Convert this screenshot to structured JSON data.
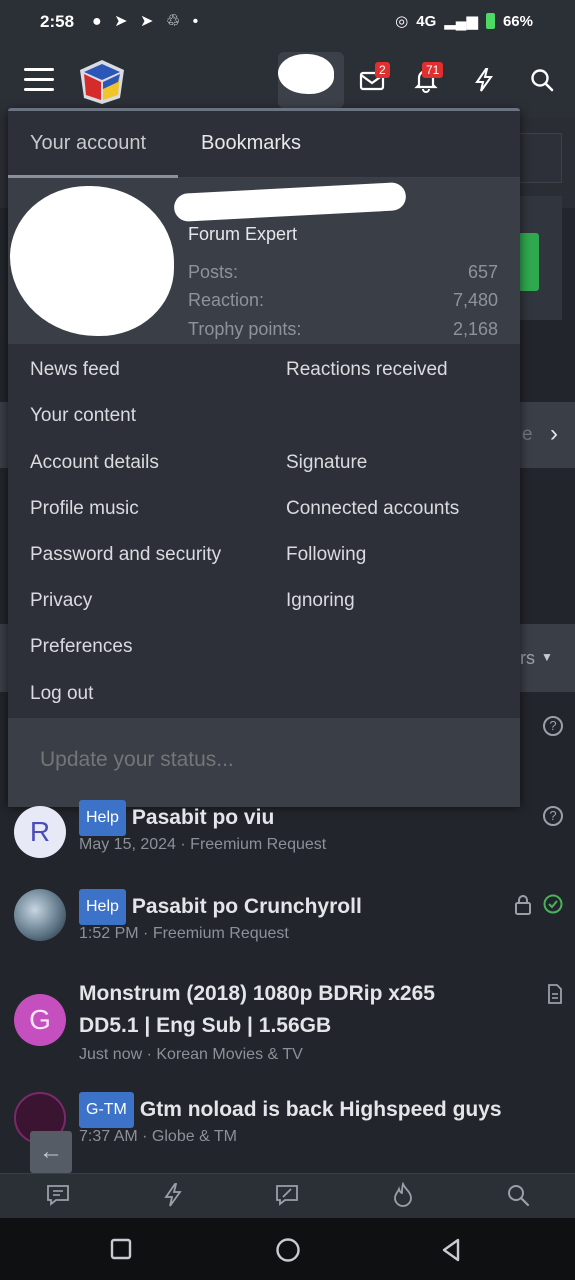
{
  "statusbar": {
    "time": "2:58",
    "network": "4G",
    "battery": "66%"
  },
  "header": {
    "conversations_badge": "2",
    "alerts_badge": "71"
  },
  "menu": {
    "tabs": [
      {
        "label": "Your account"
      },
      {
        "label": "Bookmarks"
      }
    ],
    "profile": {
      "title": "Forum Expert",
      "stats": [
        {
          "label": "Posts:",
          "value": "657"
        },
        {
          "label": "Reaction:",
          "value": "7,480"
        },
        {
          "label": "Trophy points:",
          "value": "2,168"
        }
      ]
    },
    "links": {
      "news_feed": "News feed",
      "reactions_received": "Reactions received",
      "your_content": "Your content",
      "account_details": "Account details",
      "signature": "Signature",
      "profile_music": "Profile music",
      "connected_accounts": "Connected accounts",
      "password_security": "Password and security",
      "following": "Following",
      "privacy": "Privacy",
      "ignoring": "Ignoring",
      "preferences": "Preferences",
      "log_out": "Log out"
    },
    "status_placeholder": "Update your status..."
  },
  "background": {
    "partial_text_1": "e",
    "partial_text_2": "rs"
  },
  "threads": [
    {
      "avatar_letter": "R",
      "prefix": "Help",
      "title": "Pasabit po viu",
      "date": "May 15, 2024",
      "forum": "Freemium Request"
    },
    {
      "avatar_letter": "",
      "prefix": "Help",
      "title": "Pasabit po Crunchyroll",
      "date": "1:52 PM",
      "forum": "Freemium Request"
    },
    {
      "avatar_letter": "G",
      "prefix": "",
      "title_line1": "Monstrum (2018) 1080p BDRip x265",
      "title_line2": "DD5.1 | Eng Sub | 1.56GB",
      "date": "Just now",
      "forum": "Korean Movies & TV"
    },
    {
      "avatar_letter": "",
      "prefix": "G-TM",
      "title": "Gtm noload is back Highspeed guys",
      "date": "7:37 AM",
      "forum": "Globe & TM"
    }
  ],
  "colors": {
    "prefix_blue": "#3c73c8",
    "badge_red": "#e02f2f",
    "green_button": "#2fa84f",
    "panel": "#2d3038"
  }
}
